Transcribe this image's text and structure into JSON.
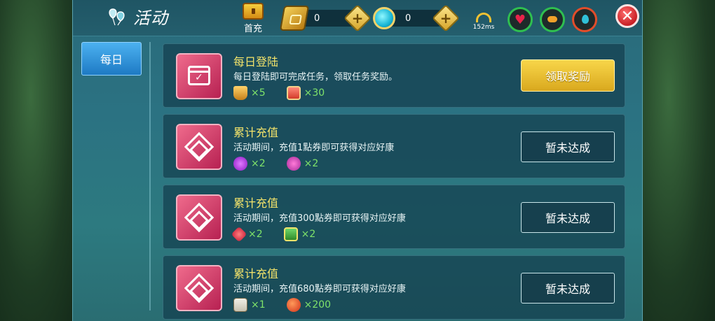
{
  "header": {
    "title": "活动",
    "first_recharge_label": "首充",
    "coupon_balance": "0",
    "gem_balance": "0",
    "ping": "152ms",
    "plus_symbol": "+",
    "close_symbol": "✕"
  },
  "tabs": [
    {
      "label": "每日",
      "selected": true
    }
  ],
  "tasks": [
    {
      "title": "每日登陆",
      "desc": "每日登陆即可完成任务，领取任务奖励。",
      "icon": "calendar-icon",
      "rewards": [
        {
          "icon": "drink-icon",
          "qty": "×5"
        },
        {
          "icon": "book-icon",
          "qty": "×30"
        }
      ],
      "button": "领取奖励",
      "state": "claimable"
    },
    {
      "title": "累计充值",
      "desc": "活动期间，充值1點券即可获得对应好康",
      "icon": "diamond-icon",
      "rewards": [
        {
          "icon": "purple-orb-icon",
          "qty": "×2"
        },
        {
          "icon": "violet-orb-icon",
          "qty": "×2"
        }
      ],
      "button": "暂未达成",
      "state": "pending"
    },
    {
      "title": "累计充值",
      "desc": "活动期间，充值300點券即可获得对应好康",
      "icon": "diamond-icon",
      "rewards": [
        {
          "icon": "red-gem-icon",
          "qty": "×2"
        },
        {
          "icon": "gift-box-icon",
          "qty": "×2"
        }
      ],
      "button": "暂未达成",
      "state": "pending"
    },
    {
      "title": "累计充值",
      "desc": "活动期间，充值680點券即可获得对应好康",
      "icon": "diamond-icon",
      "rewards": [
        {
          "icon": "scroll-icon",
          "qty": "×1"
        },
        {
          "icon": "orange-orb-icon",
          "qty": "×200"
        }
      ],
      "button": "暂未达成",
      "state": "pending"
    }
  ],
  "colors": {
    "panel": "#2b7282",
    "title_yellow": "#f3e36a",
    "reward_green": "#7fe36a",
    "claim_button": "#f8d64a",
    "tab_blue": "#1e7ac4"
  }
}
